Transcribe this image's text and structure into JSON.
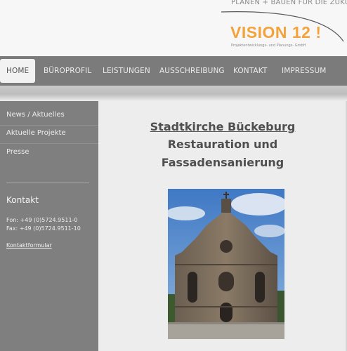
{
  "header": {
    "tagline": "PLANEN + BAUEN FÜR DIE ZUKUNFT",
    "logo_text": "VISION 12 !",
    "logo_subtitle": "Projektentwicklungs- und Planungs- GmbH",
    "accent_color": "#f2a33c"
  },
  "nav": {
    "items": [
      {
        "label": "HOME",
        "active": true
      },
      {
        "label": "BÜROPROFIL"
      },
      {
        "label": "LEISTUNGEN"
      },
      {
        "label": "AUSSCHREIBUNG"
      },
      {
        "label": "KONTAKT"
      },
      {
        "label": "IMPRESSUM"
      }
    ]
  },
  "sidebar": {
    "items": [
      {
        "label": "News / Aktuelles"
      },
      {
        "label": "Aktuelle Projekte"
      },
      {
        "label": "Presse"
      }
    ],
    "kontakt": {
      "title": "Kontakt",
      "fon": "Fon: +49 (0)5724.9511-0",
      "fax": "Fax: +49 (0)5724.9511-10",
      "link": "Kontaktformular"
    }
  },
  "main": {
    "title_line1": "Stadtkirche Bückeburg",
    "title_line2": "Restauration und",
    "title_line3": "Fassadensanierung",
    "photo_icon": "church-facade-photo"
  }
}
